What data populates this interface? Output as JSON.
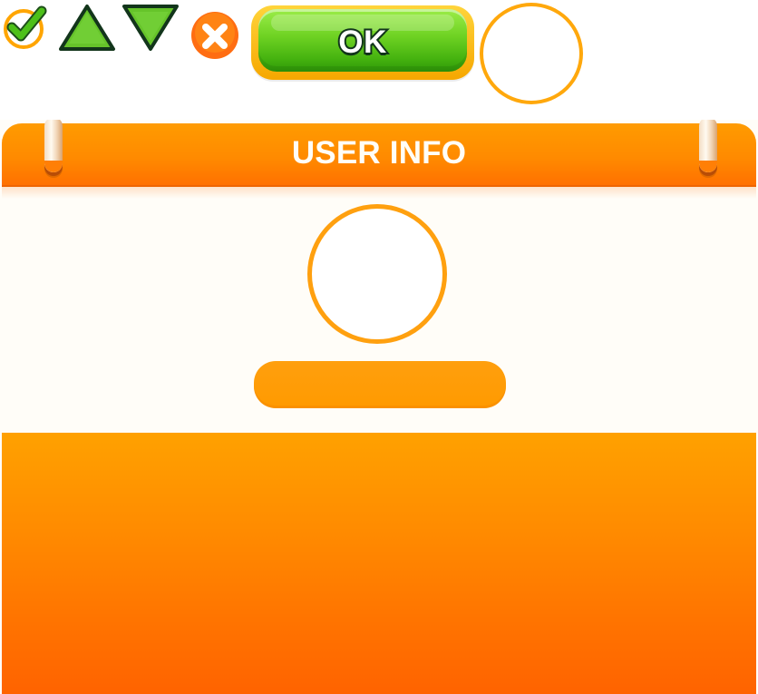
{
  "toolbar": {
    "check_icon": "check-icon",
    "up_icon": "triangle-up-icon",
    "down_icon": "triangle-down-icon",
    "close_icon": "close-icon",
    "ok_label": "OK"
  },
  "panel": {
    "title": "USER INFO",
    "avatar_icon": "avatar-placeholder-icon",
    "name_field_icon": "name-field-icon"
  },
  "colors": {
    "orange": "#ff8a00",
    "orange_dark": "#ff6300",
    "green": "#66cc22",
    "outline": "#12351b",
    "white": "#ffffff"
  }
}
